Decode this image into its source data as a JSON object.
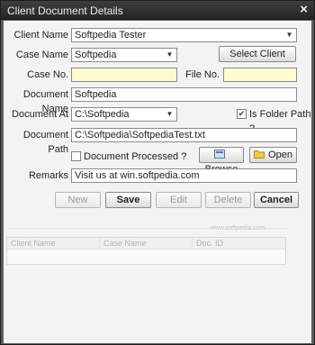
{
  "window": {
    "title": "Client Document Details",
    "close_glyph": "×"
  },
  "form": {
    "client_name_label": "Client Name",
    "client_name_value": "Softpedia Tester",
    "case_name_label": "Case Name",
    "case_name_value": "Softpedia",
    "select_client_button": "Select Client",
    "case_no_label": "Case No.",
    "case_no_value": "",
    "file_no_label": "File No.",
    "file_no_value": "",
    "document_name_label": "Document Name",
    "document_name_value": "Softpedia",
    "document_at_label": "Document At",
    "document_at_value": "C:\\Softpedia",
    "is_folder_path_label": "Is Folder Path ?",
    "is_folder_path_checked": true,
    "document_path_label": "Document Path",
    "document_path_value": "C:\\Softpedia\\SoftpediaTest.txt",
    "document_processed_label": "Document Processed ?",
    "document_processed_checked": false,
    "browse_button": "Browse",
    "open_button": "Open",
    "remarks_label": "Remarks",
    "remarks_value": "Visit us at win.softpedia.com"
  },
  "actions": {
    "new": "New",
    "save": "Save",
    "edit": "Edit",
    "delete": "Delete",
    "cancel": "Cancel"
  },
  "grid": {
    "columns": [
      "Client Name",
      "Case Name",
      "Doc. ID"
    ]
  },
  "watermark": "www.softpedia.com",
  "colors": {
    "title_bar": "#2f2f2f",
    "frame": "#5d5d5d",
    "client_area": "#f3f3f3",
    "yellow_field": "#fffbd0"
  }
}
